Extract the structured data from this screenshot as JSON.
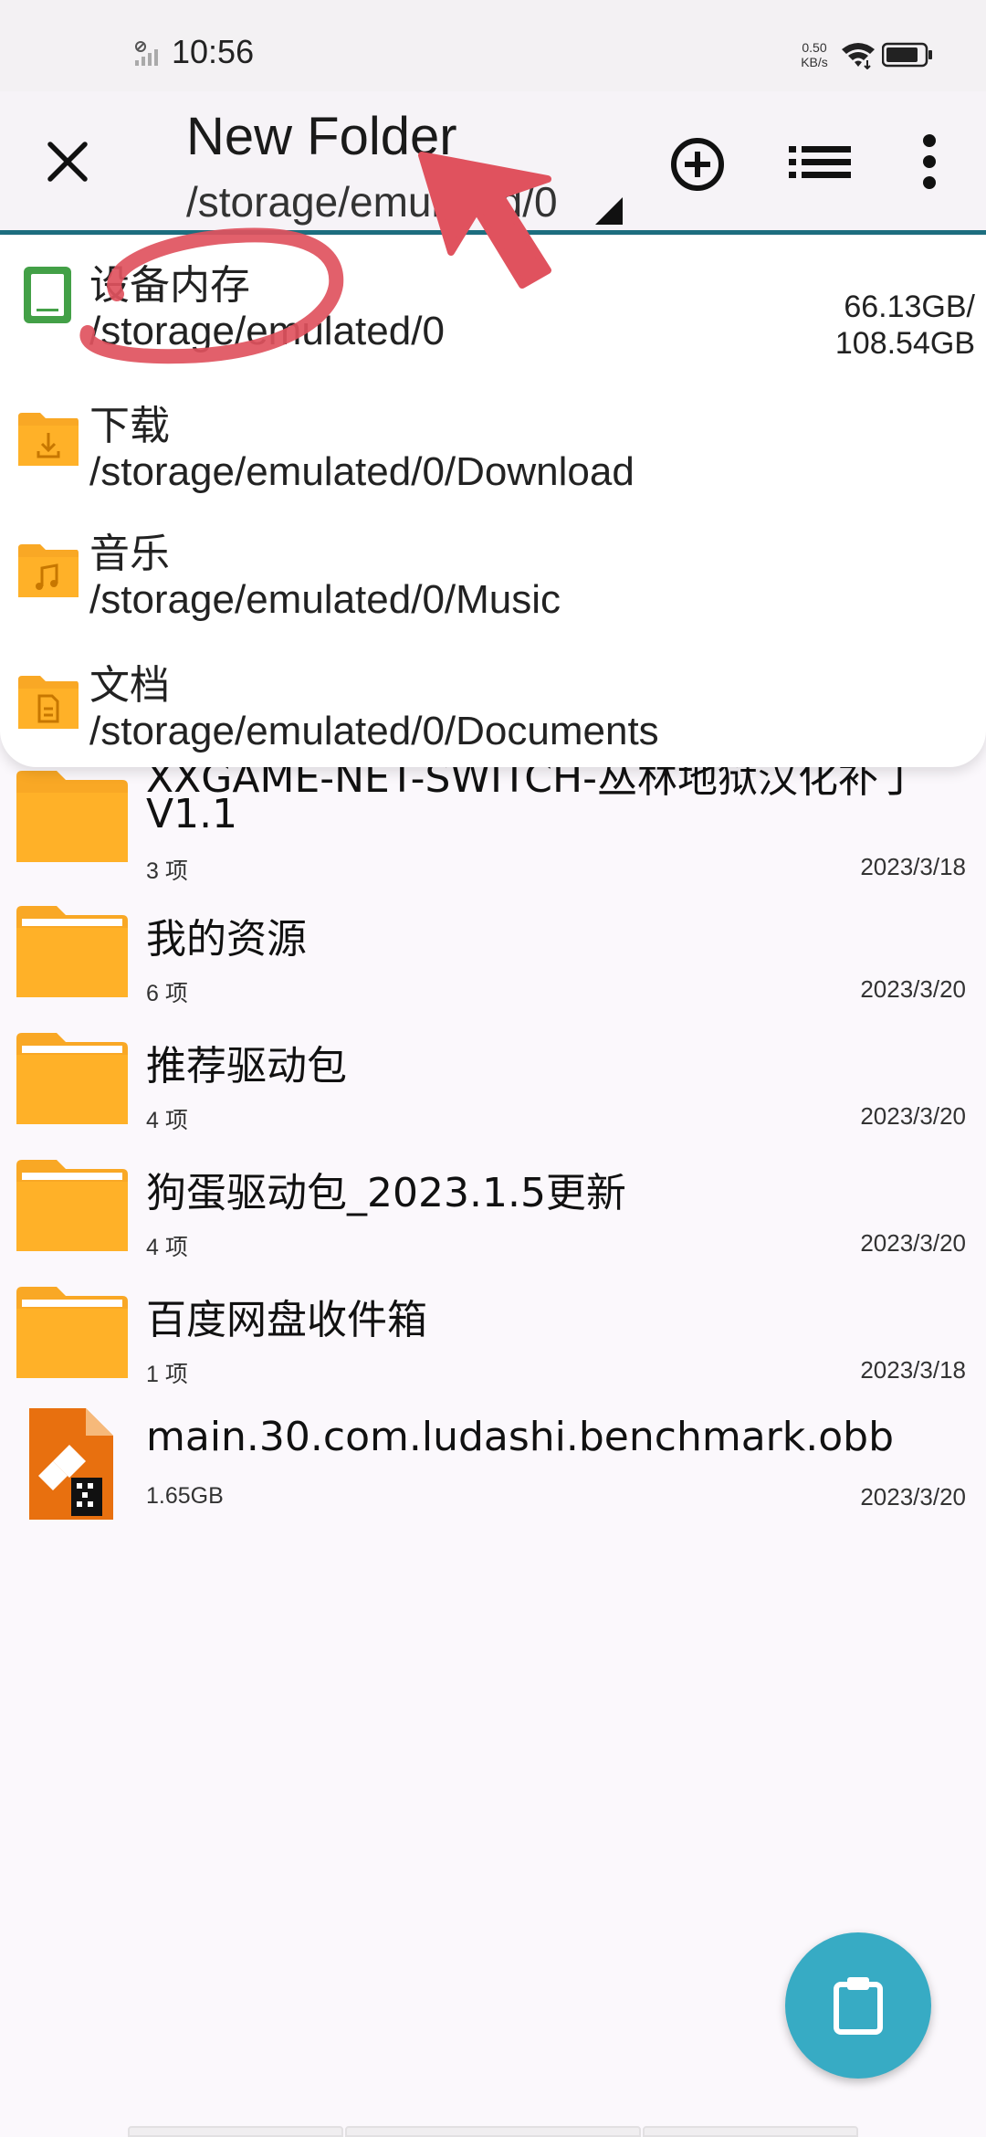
{
  "status_bar": {
    "time": "10:56",
    "speed_value": "0.50",
    "speed_unit": "KB/s"
  },
  "app_bar": {
    "title": "New Folder",
    "subtitle": "/storage/emulated/0",
    "accent_color": "#1e6f80"
  },
  "dropdown": {
    "items": [
      {
        "label": "设备内存",
        "path": "/storage/emulated/0",
        "size_line1": "66.13GB/",
        "size_line2": "108.54GB",
        "icon": "storage-icon"
      },
      {
        "label": "下载",
        "path": "/storage/emulated/0/Download",
        "icon": "download-folder-icon"
      },
      {
        "label": "音乐",
        "path": "/storage/emulated/0/Music",
        "icon": "music-folder-icon"
      },
      {
        "label": "文档",
        "path": "/storage/emulated/0/Documents",
        "icon": "documents-folder-icon"
      }
    ]
  },
  "files": [
    {
      "name": "XXGAME-NET-SWITCH-丛林地狱汉化补丁",
      "name2": "V1.1",
      "meta": "3 项",
      "date": "2023/3/18",
      "icon": "folder-icon"
    },
    {
      "name": "我的资源",
      "meta": "6 项",
      "date": "2023/3/20",
      "icon": "folder-icon"
    },
    {
      "name": "推荐驱动包",
      "meta": "4 项",
      "date": "2023/3/20",
      "icon": "folder-icon"
    },
    {
      "name": "狗蛋驱动包_2023.1.5更新",
      "meta": "4 项",
      "date": "2023/3/20",
      "icon": "folder-icon"
    },
    {
      "name": "百度网盘收件箱",
      "meta": "1 项",
      "date": "2023/3/18",
      "icon": "folder-icon"
    },
    {
      "name": "main.30.com.ludashi.benchmark.obb",
      "meta": "1.65GB",
      "date": "2023/3/20",
      "icon": "archive-file-icon"
    }
  ],
  "fab": {
    "icon": "clipboard-icon",
    "color": "#37abc4"
  },
  "colors": {
    "folder": "#f9a825",
    "annotation": "#e0525e"
  }
}
